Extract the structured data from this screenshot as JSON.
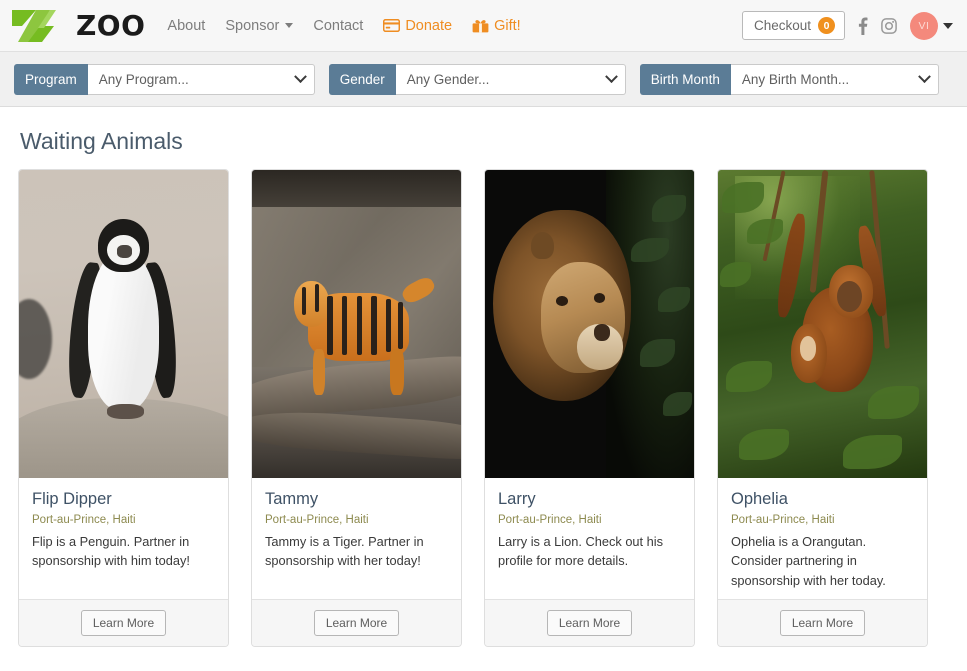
{
  "header": {
    "logo_text": "ZOO",
    "logo_icon": "zoo-z-logo-icon",
    "nav": [
      {
        "label": "About",
        "icon": null,
        "has_caret": false,
        "style": "gray"
      },
      {
        "label": "Sponsor",
        "icon": null,
        "has_caret": true,
        "style": "gray"
      },
      {
        "label": "Contact",
        "icon": null,
        "has_caret": false,
        "style": "gray"
      },
      {
        "label": "Donate",
        "icon": "credit-card-icon",
        "has_caret": false,
        "style": "orange"
      },
      {
        "label": "Gift!",
        "icon": "gift-icon",
        "has_caret": false,
        "style": "orange"
      }
    ],
    "checkout": {
      "label": "Checkout",
      "count": "0",
      "badge_color": "#f0901e"
    },
    "social": [
      {
        "name": "facebook-icon"
      },
      {
        "name": "instagram-icon"
      }
    ],
    "account": {
      "initials": "VI",
      "avatar_color": "#f4897c"
    }
  },
  "filters": [
    {
      "label": "Program",
      "value": "Any Program...",
      "name": "program"
    },
    {
      "label": "Gender",
      "value": "Any Gender...",
      "name": "gender"
    },
    {
      "label": "Birth Month",
      "value": "Any Birth Month...",
      "name": "birth-month"
    }
  ],
  "main": {
    "title": "Waiting Animals",
    "cards": [
      {
        "name": "Flip Dipper",
        "location": "Port-au-Prince, Haiti",
        "description": "Flip is a Penguin. Partner in sponsorship with him today!",
        "button": "Learn More",
        "photo": "penguin-photo"
      },
      {
        "name": "Tammy",
        "location": "Port-au-Prince, Haiti",
        "description": "Tammy is a Tiger. Partner in sponsorship with her today!",
        "button": "Learn More",
        "photo": "tiger-photo"
      },
      {
        "name": "Larry",
        "location": "Port-au-Prince, Haiti",
        "description": "Larry is a Lion. Check out his profile for more details.",
        "button": "Learn More",
        "photo": "lion-photo"
      },
      {
        "name": "Ophelia",
        "location": "Port-au-Prince, Haiti",
        "description": "Ophelia is a Orangutan. Consider partnering in sponsorship with her today.",
        "button": "Learn More",
        "photo": "orangutan-photo"
      }
    ]
  },
  "colors": {
    "brand_green": "#76bc21",
    "accent_orange": "#ef8d22",
    "filter_slate": "#5b7c96",
    "title_slate": "#4a5b6b",
    "location_olive": "#8d8a4f"
  }
}
